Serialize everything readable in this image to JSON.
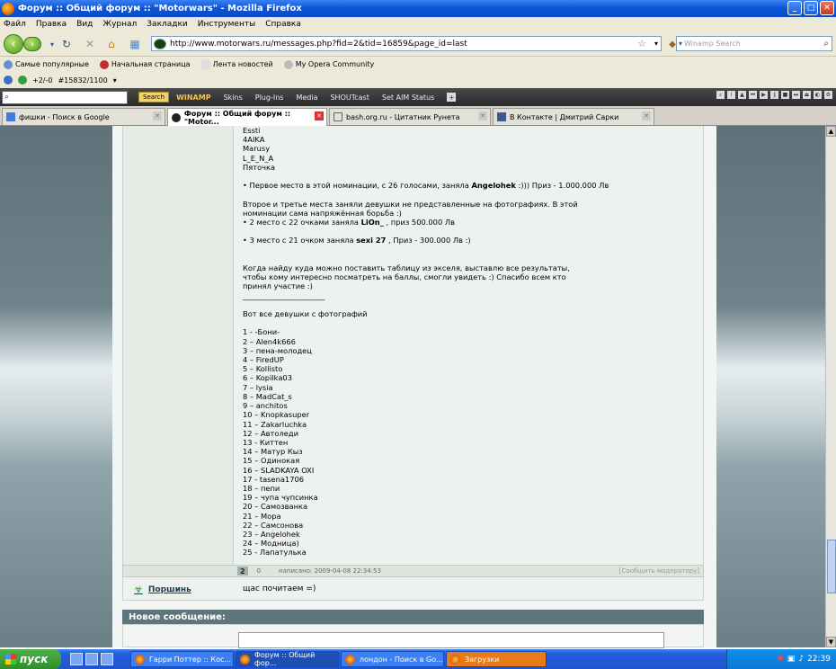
{
  "window": {
    "title": "Форум :: Общий форум :: \"Motorwars\" - Mozilla Firefox",
    "btn_min": "_",
    "btn_max": "□",
    "btn_close": "✕"
  },
  "menu": [
    "Файл",
    "Правка",
    "Вид",
    "Журнал",
    "Закладки",
    "Инструменты",
    "Справка"
  ],
  "nav": {
    "url": "http://www.motorwars.ru/messages.php?fid=2&tid=16859&page_id=last",
    "search_placeholder": "Winamp Search"
  },
  "bookmarks": [
    "Самые популярные",
    "Начальная страница",
    "Лента новостей",
    "My Opera Community"
  ],
  "toolbar3": {
    "counter1": "+2/-0",
    "counter2": "#15832/1100"
  },
  "winamp": {
    "search_btn": "Search",
    "logo": "WINAMP",
    "menu": [
      "Skins",
      "Plug-Ins",
      "Media",
      "SHOUTcast",
      "Set AIM Status"
    ]
  },
  "tabs": [
    {
      "label": "фишки - Поиск в Google",
      "color": "#3d7de0"
    },
    {
      "label": "Форум :: Общий форум :: \"Motor...",
      "color": "#222"
    },
    {
      "label": "bash.org.ru - Цитатник Рунета",
      "color": "#888"
    },
    {
      "label": "В Контакте | Дмитрий Сарки",
      "color": "#3b5b8c"
    }
  ],
  "post": {
    "lines_top": [
      "Essti",
      "4AIKA",
      "Marusy",
      "L_E_N_A",
      "Пяточка"
    ],
    "first_place": {
      "pre": "• Первое место в этой номинации, с 26 голосами, заняла ",
      "name": "Angelohek",
      "post": " :))) Приз - 1.000.000 Лв"
    },
    "para2a": "Второе и третье места заняли девушки не представленные на фотографиях. В этой",
    "para2b": "номинации сама напряжённая борьба :)",
    "second": {
      "pre": "• 2 место с 22 очками заняла ",
      "name": "LiOn_",
      "post": " , приз 500.000 Лв"
    },
    "third": {
      "pre": "• 3 место с 21 очком заняла ",
      "name": "sexi 27",
      "post": " , Приз - 300.000 Лв :)"
    },
    "para3a": "Когда найду куда можно поставить таблицу из экселя, выставлю все результаты,",
    "para3b": "чтобы кому интересно посматреть на баллы, смогли увидеть :) Спасибо всем кто",
    "para3c": "принял участие :)",
    "divider": "______________________",
    "list_heading": "Вот все девушки с фотографий",
    "list": [
      "1 - -Бони-",
      "2 – Alen4k666",
      "3 – пена-молодец",
      "4 – FiredUP",
      "5 – Kollisto",
      "6 – Kopilka03",
      "7 – lysia",
      "8 – MadCat_s",
      "9 – anchitos",
      "10 – Knopkasuper",
      "11 – Zakarluchka",
      "12 – Автоледи",
      "13 - Киттен",
      "14 – Матур Кыз",
      "15 – Одинокая",
      "16 – SLADKAYA OXI",
      "17 - tasena1706",
      "18 – пепи",
      "19 – чупа чупсинка",
      "20 – Самозванка",
      "21 – Мора",
      "22 – Самсонова",
      "23 – Angelohek",
      "24 – Модница)",
      "25 - Лапатулька"
    ]
  },
  "reply": {
    "number": "2",
    "zero": "0",
    "meta": "написано: 2009-04-08 22:34:53",
    "report": "[Сообщить модератору]",
    "author": "Поршинь",
    "text": "щас почитаем =)"
  },
  "new_message": "Новое сообщение:",
  "taskbar": {
    "start": "пуск",
    "tasks": [
      "Гарри Поттер :: Кос...",
      "Форум :: Общий фор...",
      "лондон - Поиск в Go...",
      "Загрузки"
    ],
    "lang": "RU",
    "clock": "22:39"
  }
}
